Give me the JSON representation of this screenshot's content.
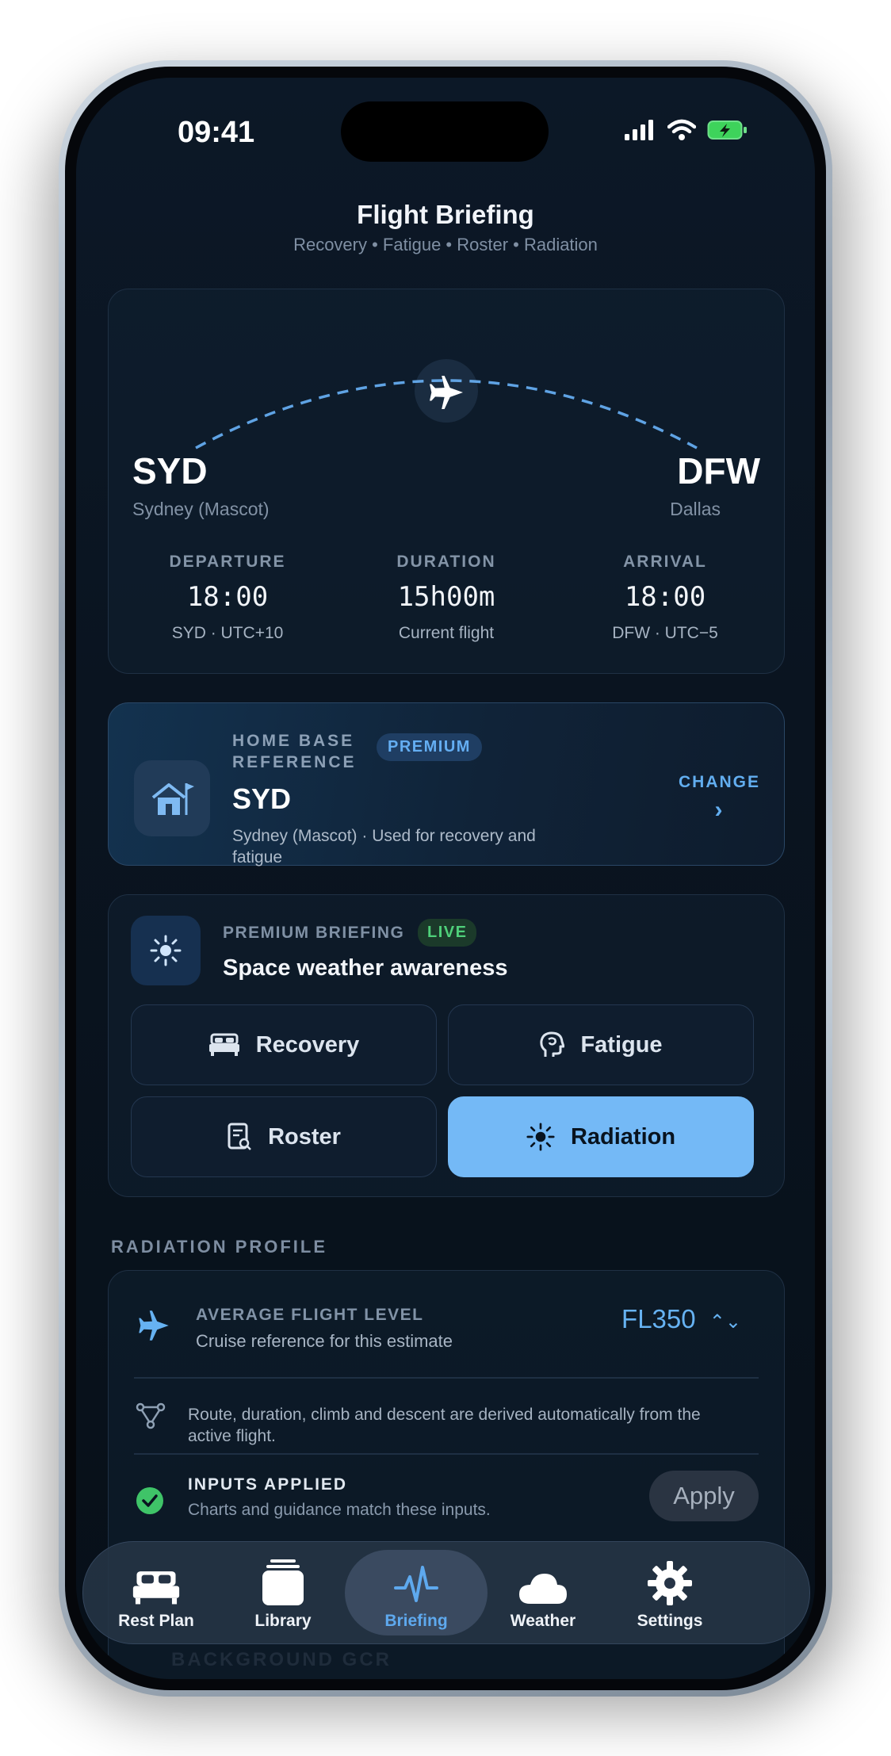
{
  "status": {
    "time": "09:41"
  },
  "header": {
    "title": "Flight Briefing",
    "subtitle": "Recovery • Fatigue • Roster • Radiation"
  },
  "flight": {
    "origin": {
      "code": "SYD",
      "city": "Sydney (Mascot)"
    },
    "destination": {
      "code": "DFW",
      "city": "Dallas"
    },
    "departure": {
      "label": "DEPARTURE",
      "time": "18:00",
      "note": "SYD · UTC+10"
    },
    "duration": {
      "label": "DURATION",
      "value": "15h00m",
      "note": "Current flight"
    },
    "arrival": {
      "label": "ARRIVAL",
      "time": "18:00",
      "note": "DFW · UTC−5"
    }
  },
  "home_base": {
    "label_line1": "HOME BASE",
    "label_line2": "REFERENCE",
    "badge": "PREMIUM",
    "code": "SYD",
    "description": "Sydney (Mascot) · Used for recovery and fatigue",
    "change_label": "CHANGE"
  },
  "briefing": {
    "label": "PREMIUM BRIEFING",
    "badge": "LIVE",
    "title": "Space weather awareness",
    "tabs": [
      {
        "label": "Recovery",
        "icon": "bed-icon",
        "active": false
      },
      {
        "label": "Fatigue",
        "icon": "head-icon",
        "active": false
      },
      {
        "label": "Roster",
        "icon": "roster-icon",
        "active": false
      },
      {
        "label": "Radiation",
        "icon": "sun-icon",
        "active": true
      }
    ]
  },
  "radiation": {
    "section_title": "RADIATION PROFILE",
    "flight_level_label": "AVERAGE FLIGHT LEVEL",
    "flight_level_sub": "Cruise reference for this estimate",
    "flight_level_value": "FL350",
    "route_note": "Route, duration, climb and descent are derived automatically from the active flight.",
    "inputs_label": "INPUTS APPLIED",
    "inputs_sub": "Charts and guidance match these inputs.",
    "apply_label": "Apply",
    "background_label": "BACKGROUND GCR"
  },
  "tabbar": [
    {
      "label": "Rest Plan",
      "icon": "bed-icon",
      "active": false
    },
    {
      "label": "Library",
      "icon": "stack-icon",
      "active": false
    },
    {
      "label": "Briefing",
      "icon": "pulse-icon",
      "active": true
    },
    {
      "label": "Weather",
      "icon": "cloud-icon",
      "active": false
    },
    {
      "label": "Settings",
      "icon": "gear-icon",
      "active": false
    }
  ],
  "colors": {
    "accent": "#74b9f6",
    "live": "#4fd07a",
    "background": "#0a1420"
  }
}
